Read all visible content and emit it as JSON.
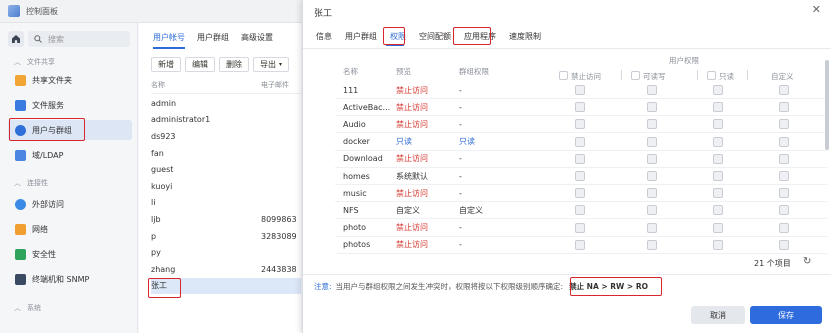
{
  "cp": {
    "title": "控制面板",
    "search_placeholder": "搜索",
    "sections": {
      "file_sharing": "文件共享",
      "connectivity": "连接性",
      "system": "系统"
    },
    "sidebar_items": [
      "共享文件夹",
      "文件服务",
      "用户与群组",
      "域/LDAP",
      "外部访问",
      "网络",
      "安全性",
      "终端机和 SNMP"
    ],
    "tabs": [
      "用户帐号",
      "用户群组",
      "高级设置"
    ],
    "toolbar": [
      "新增",
      "编辑",
      "删除",
      "导出"
    ],
    "columns": [
      "名称",
      "电子邮件"
    ],
    "users": [
      {
        "name": "admin",
        "email": ""
      },
      {
        "name": "administrator1",
        "email": ""
      },
      {
        "name": "ds923",
        "email": ""
      },
      {
        "name": "fan",
        "email": ""
      },
      {
        "name": "guest",
        "email": ""
      },
      {
        "name": "kuoyi",
        "email": ""
      },
      {
        "name": "li",
        "email": ""
      },
      {
        "name": "ljb",
        "email": "8099863"
      },
      {
        "name": "p",
        "email": "3283089"
      },
      {
        "name": "py",
        "email": ""
      },
      {
        "name": "zhang",
        "email": "2443838"
      },
      {
        "name": "张工",
        "email": ""
      }
    ]
  },
  "dialog": {
    "title": "张工",
    "tabs": [
      "信息",
      "用户群组",
      "权限",
      "空间配额",
      "应用程序",
      "速度限制"
    ],
    "headers": {
      "name": "名称",
      "preview": "预览",
      "group_perm": "群组权限",
      "user_perm": "用户权限",
      "deny": "禁止访问",
      "rw": "可读写",
      "ro": "只读",
      "custom": "自定义"
    },
    "rows": [
      {
        "name": "111",
        "preview": "禁止访问",
        "group": "-",
        "preview_color": "red",
        "group_color": "dark"
      },
      {
        "name": "ActiveBac...",
        "preview": "禁止访问",
        "group": "-",
        "preview_color": "red",
        "group_color": "dark"
      },
      {
        "name": "Audio",
        "preview": "禁止访问",
        "group": "-",
        "preview_color": "red",
        "group_color": "dark"
      },
      {
        "name": "docker",
        "preview": "只读",
        "group": "只读",
        "preview_color": "blue",
        "group_color": "blue"
      },
      {
        "name": "Download",
        "preview": "禁止访问",
        "group": "-",
        "preview_color": "red",
        "group_color": "dark"
      },
      {
        "name": "homes",
        "preview": "系统默认",
        "group": "-",
        "preview_color": "dark",
        "group_color": "dark"
      },
      {
        "name": "music",
        "preview": "禁止访问",
        "group": "-",
        "preview_color": "red",
        "group_color": "dark"
      },
      {
        "name": "NFS",
        "preview": "自定义",
        "group": "自定义",
        "preview_color": "dark",
        "group_color": "dark"
      },
      {
        "name": "photo",
        "preview": "禁止访问",
        "group": "-",
        "preview_color": "red",
        "group_color": "dark"
      },
      {
        "name": "photos",
        "preview": "禁止访问",
        "group": "-",
        "preview_color": "red",
        "group_color": "dark"
      }
    ],
    "count": "21 个项目",
    "note_label": "注意:",
    "note_text": "当用户与群组权限之间发生冲突时，权限将按以下权限级别顺序确定:",
    "note_order": "禁止 NA > RW > RO",
    "cancel": "取消",
    "save": "保存"
  },
  "colors": {
    "accent": "#2d6bd6",
    "deny": "#d33a31",
    "highlight": "#d8262c"
  }
}
